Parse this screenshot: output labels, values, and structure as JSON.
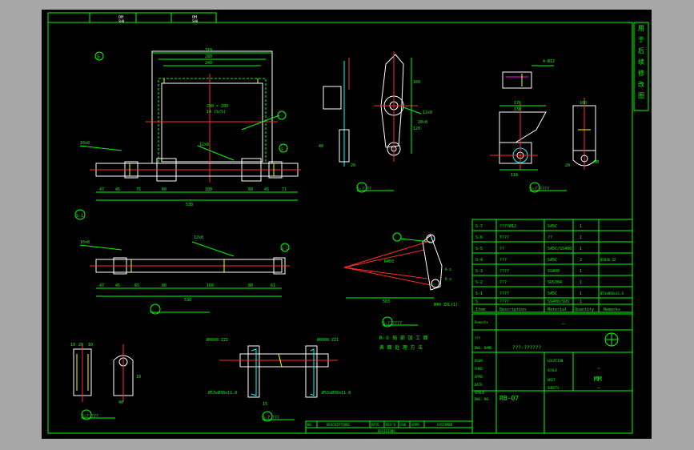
{
  "top_header": {
    "left_label": "OH",
    "right_label": "OH",
    "left_sub": "SH0",
    "right_sub": "SH0"
  },
  "side_strip": [
    "用",
    "于",
    "后",
    "续",
    "修",
    "改",
    "图"
  ],
  "colors": {
    "frame_bg": "#000000",
    "border": "#00ff00",
    "text": "#00ff00",
    "accent": "#ffffff",
    "centerline": "#ff2a2a",
    "highlight": "#00ffff",
    "dim_marker": "#ffff00",
    "outer_bg": "#a7a7a7"
  },
  "views": {
    "top_main": {
      "label": "S",
      "dims_top": [
        "310",
        "280",
        "240"
      ],
      "dims_bottom": [
        "47",
        "45",
        "75",
        "60",
        "180",
        "60",
        "45",
        "71"
      ],
      "total": "538",
      "note1": "200 × 200",
      "note2": "14 (S/S)",
      "note3": "12x8",
      "note4": "10x8",
      "mark": "S"
    },
    "second_shaft": {
      "label": "S-1",
      "dims_bottom": [
        "47",
        "45",
        "65",
        "80",
        "160",
        "80",
        "61"
      ],
      "total": "538",
      "note1": "12x8",
      "note2": "10x8",
      "mark": "S-1"
    },
    "lever_view": {
      "dims": [
        "160",
        "120",
        "40",
        "20"
      ],
      "note1": "12x8",
      "note2": "20×8",
      "caption": "S-? ??"
    },
    "bracket_view": {
      "dims": [
        "176",
        "130",
        "110",
        "100",
        "20"
      ],
      "note1": "4-Ø12",
      "note2": "MM",
      "caption": "S-? ????"
    },
    "assembly_view": {
      "note1": "R403",
      "note2": "503",
      "note3": "Ø40 ZOL(1)",
      "caption": "S-? ????",
      "tick1": "R-①",
      "tick2": "R-②"
    },
    "small_part": {
      "dims_top": [
        "10",
        "20",
        "10"
      ],
      "dims_side": [
        "10",
        "40"
      ],
      "caption": "S-? ???"
    },
    "bearing_view": {
      "label_left": "Ø0008 ZZ1",
      "label_right": "Ø0008 ZZ1",
      "bottom_left": "Ø53xØ38x11.8",
      "bottom_right": "Ø53xØ38x11.8",
      "dim": "15",
      "caption": "S-? ???"
    }
  },
  "notes_block": {
    "line1": "R-① 局 部 加 工 面",
    "line2": "表 面 处 理 方 法"
  },
  "bom": {
    "rows": [
      {
        "item": "S-7",
        "desc": "????Ø12",
        "material": "S45C",
        "qty": "1",
        "remark": ""
      },
      {
        "item": "S-6",
        "desc": "Y???",
        "material": "??",
        "qty": "1",
        "remark": ""
      },
      {
        "item": "S-5",
        "desc": "??",
        "material": "S45C/SS400",
        "qty": "1",
        "remark": ""
      },
      {
        "item": "S-4",
        "desc": "???",
        "material": "S45C",
        "qty": "2",
        "remark": "Ø5030 ZZ"
      },
      {
        "item": "S-3",
        "desc": "????",
        "material": "SS400",
        "qty": "1",
        "remark": ""
      },
      {
        "item": "S-2",
        "desc": "???",
        "material": "SUS304",
        "qty": "1",
        "remark": ""
      },
      {
        "item": "S-1",
        "desc": "????",
        "material": "S45C",
        "qty": "1",
        "remark": "Ø53xØ38x11.8"
      },
      {
        "item": "S",
        "desc": "????",
        "material": "SS400/SUS",
        "qty": "1",
        "remark": ""
      }
    ],
    "headers": {
      "item": "Item",
      "desc": "Description",
      "material": "Material",
      "qty": "Quantity",
      "remark": "Remarks"
    }
  },
  "title_block": {
    "remarks_label": "Remarks",
    "remarks_value": "–",
    "proj_label": "???",
    "drawing_name": "???-??????",
    "dwg_name_label": "DWG. NAME",
    "rows_left": [
      "DSGN",
      "CHKD",
      "APPD",
      "DATE",
      "SCALE"
    ],
    "rows_mid": [
      "LOCATION",
      "SCALE",
      "UNIT",
      "SHEETS"
    ],
    "scale_value": "~",
    "unit_value": "MM",
    "sheet_value": "–",
    "dwg_no_label": "DWG. NO.",
    "dwg_no": "RB-07"
  },
  "revisions": {
    "headers": [
      "NO.",
      "DESCRIPTIONS",
      "DATE",
      "REV'D",
      "CHK",
      "APPR",
      "CUSTOMER"
    ],
    "footer": "REVISIONS"
  }
}
